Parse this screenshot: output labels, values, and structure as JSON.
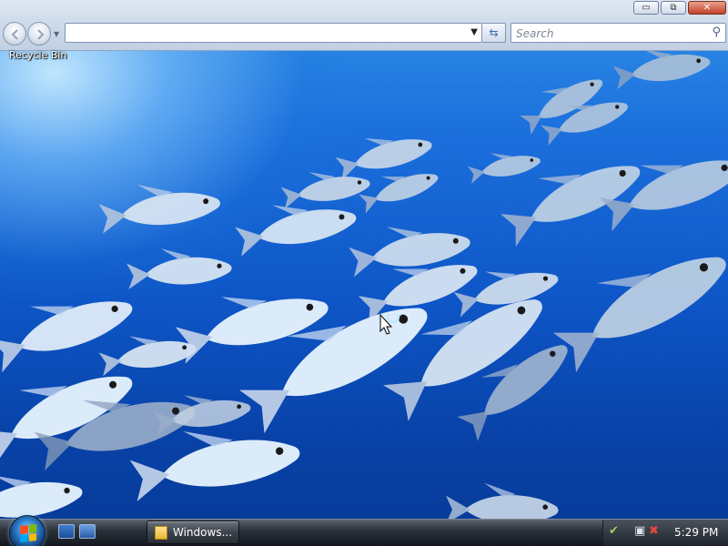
{
  "window": {
    "controls": {
      "minimize": "▭",
      "maximize": "⧉",
      "close": "✕"
    },
    "address": {
      "value": ""
    },
    "search": {
      "placeholder": "Search"
    }
  },
  "desktop": {
    "icons": [
      {
        "label": "Recycle Bin",
        "icon": "recycle-bin-icon"
      }
    ]
  },
  "taskbar": {
    "start_icon": "windows-start-orb",
    "quick_launch": [
      "show-desktop-icon",
      "switch-windows-icon"
    ],
    "tasks": [
      {
        "label": "Windows...",
        "icon": "folder-icon"
      }
    ],
    "tray_icons": [
      "network-check-icon",
      "network-disconnected-icon",
      "volume-muted-icon"
    ],
    "clock": "5:29 PM"
  },
  "colors": {
    "wallpaper_top": "#2f8ee8",
    "wallpaper_bottom": "#063a96",
    "taskbar": "#141820"
  }
}
